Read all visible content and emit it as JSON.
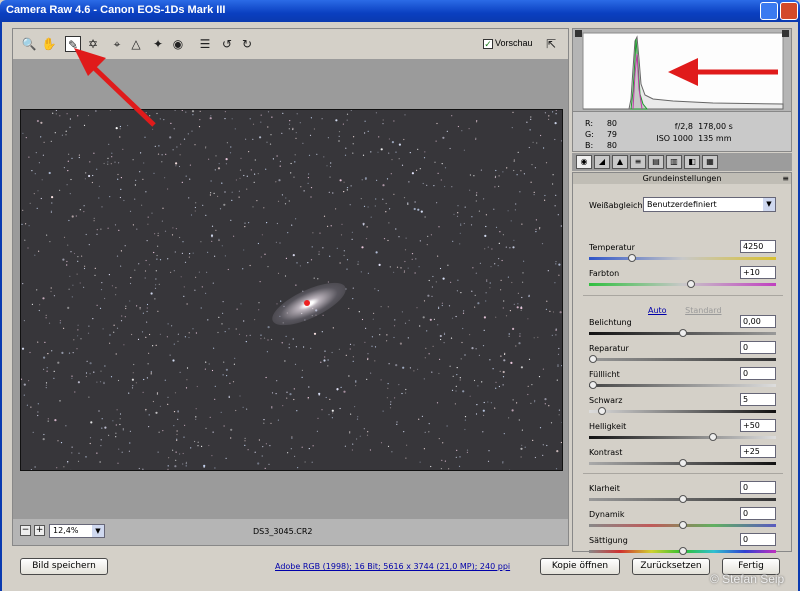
{
  "window": {
    "title": "Camera Raw 4.6 - Canon EOS-1Ds Mark III"
  },
  "toolbar": {
    "tools": [
      "zoom-icon",
      "hand-icon",
      "white-balance-icon",
      "color-sampler-icon",
      "crop-icon",
      "straighten-icon",
      "retouch-icon",
      "red-eye-icon",
      "preferences-icon",
      "rotate-left-icon",
      "rotate-right-icon"
    ],
    "preview_label": "Vorschau",
    "preview_checked": true
  },
  "bottom": {
    "zoom": "12,4%",
    "filename": "DS3_3045.CR2"
  },
  "info": {
    "r_label": "R:",
    "r": "80",
    "g_label": "G:",
    "g": "79",
    "b_label": "B:",
    "b": "80",
    "aperture": "f/2,8",
    "shutter": "178,00 s",
    "iso": "ISO 1000",
    "focal": "135 mm"
  },
  "panel": {
    "title": "Grundeinstellungen",
    "wb_label": "Weißabgleich:",
    "wb_value": "Benutzerdefiniert",
    "auto": "Auto",
    "standard": "Standard",
    "sliders": [
      {
        "label": "Temperatur",
        "value": "4250",
        "pos": 0.22
      },
      {
        "label": "Farbton",
        "value": "+10",
        "pos": 0.55
      },
      {
        "label": "Belichtung",
        "value": "0,00",
        "pos": 0.5
      },
      {
        "label": "Reparatur",
        "value": "0",
        "pos": 0.0
      },
      {
        "label": "Fülllicht",
        "value": "0",
        "pos": 0.0
      },
      {
        "label": "Schwarz",
        "value": "5",
        "pos": 0.05
      },
      {
        "label": "Helligkeit",
        "value": "+50",
        "pos": 0.67
      },
      {
        "label": "Kontrast",
        "value": "+25",
        "pos": 0.5
      },
      {
        "label": "Klarheit",
        "value": "0",
        "pos": 0.5
      },
      {
        "label": "Dynamik",
        "value": "0",
        "pos": 0.5
      },
      {
        "label": "Sättigung",
        "value": "0",
        "pos": 0.5
      }
    ]
  },
  "footer": {
    "save": "Bild speichern",
    "workflow": "Adobe RGB (1998); 16 Bit; 5616 x 3744 (21,0 MP); 240 ppi",
    "open_copy": "Kopie öffnen",
    "reset": "Zurücksetzen",
    "done": "Fertig",
    "copyright": "© Stefan Seip"
  },
  "colors": {
    "arrow": "#e01b1b",
    "title_bar": "#0a3fc0",
    "photo_bg": "#37363a"
  }
}
